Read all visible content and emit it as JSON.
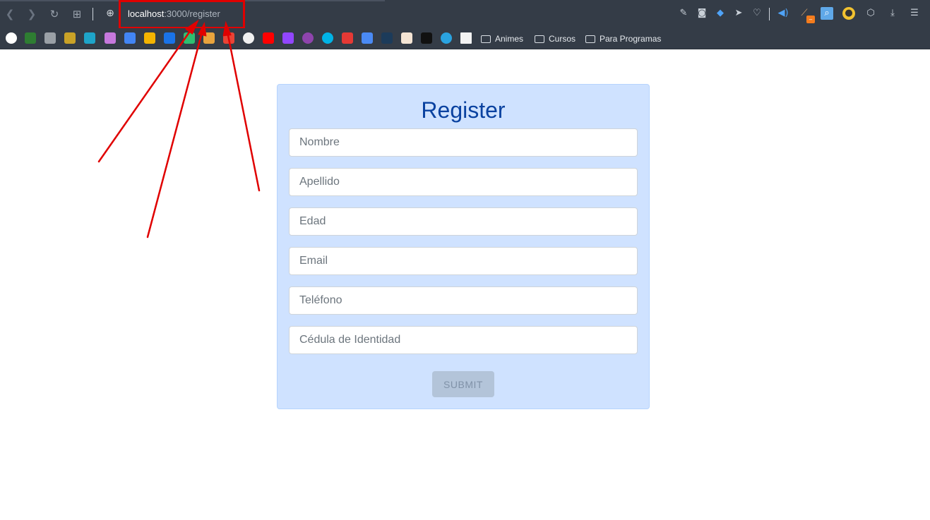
{
  "browser": {
    "url_host": "localhost",
    "url_rest": ":3000/register",
    "bookmark_folders": [
      "Animes",
      "Cursos",
      "Para Programas"
    ],
    "extension_badge": "–"
  },
  "form": {
    "title": "Register",
    "fields": [
      {
        "placeholder": "Nombre"
      },
      {
        "placeholder": "Apellido"
      },
      {
        "placeholder": "Edad"
      },
      {
        "placeholder": "Email"
      },
      {
        "placeholder": "Teléfono"
      },
      {
        "placeholder": "Cédula de Identidad"
      }
    ],
    "submit_label": "SUBMIT"
  },
  "colors": {
    "annotation": "#e00000",
    "card_bg": "#cfe2ff",
    "title": "#0a42a0"
  }
}
